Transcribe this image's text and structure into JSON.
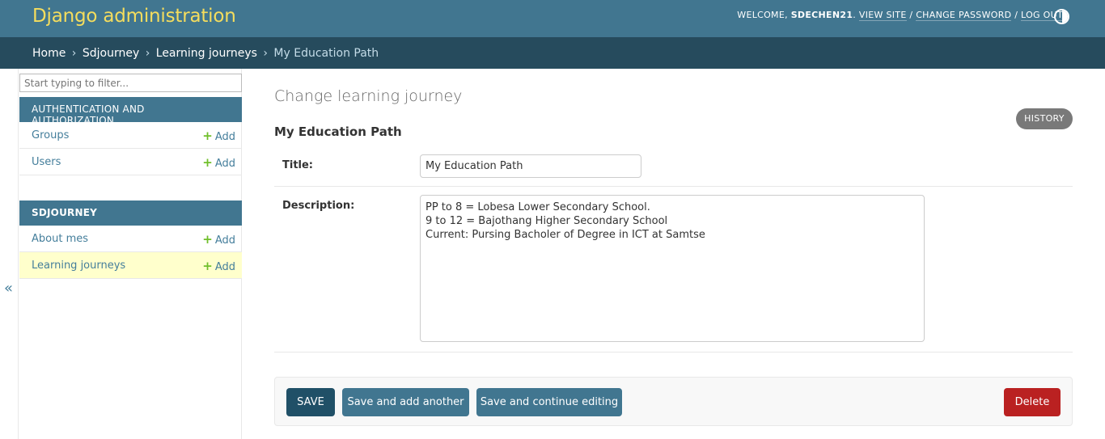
{
  "header": {
    "brand": "Django administration",
    "welcome": "Welcome,",
    "username": "sdechen21",
    "period": ".",
    "view_site": "View site",
    "change_password": "Change password",
    "log_out": "Log out",
    "sep": "/"
  },
  "breadcrumbs": {
    "items": [
      "Home",
      "Sdjourney",
      "Learning journeys"
    ],
    "current": "My Education Path",
    "separator": "›"
  },
  "sidebar": {
    "filter_placeholder": "Start typing to filter...",
    "modules": [
      {
        "caption": "Authentication and Authorization",
        "models": [
          {
            "name": "Groups",
            "add": "Add"
          },
          {
            "name": "Users",
            "add": "Add"
          }
        ]
      },
      {
        "caption": "Sdjourney",
        "models": [
          {
            "name": "About mes",
            "add": "Add"
          },
          {
            "name": "Learning journeys",
            "add": "Add"
          }
        ]
      }
    ],
    "toggle": "«"
  },
  "content": {
    "title": "Change learning journey",
    "object_title": "My Education Path",
    "history": "History",
    "fields": {
      "title_label": "Title:",
      "title_value": "My Education Path",
      "description_label": "Description:",
      "description_value": "PP to 8 = Lobesa Lower Secondary School.\n9 to 12 = Bajothang Higher Secondary School\nCurrent: Pursing Bacholer of Degree in ICT at Samtse"
    }
  },
  "submit": {
    "save": "Save",
    "save_add": "Save and add another",
    "save_continue": "Save and continue editing",
    "delete": "Delete"
  },
  "colors": {
    "header": "#417690",
    "breadcrumbs": "#264b5d",
    "brand": "#f5dd5d",
    "link": "#447e9b",
    "add_plus": "#70bf2b",
    "selected_row": "#ffffcc",
    "save_button": "#205067",
    "delete_button": "#ba2121"
  }
}
